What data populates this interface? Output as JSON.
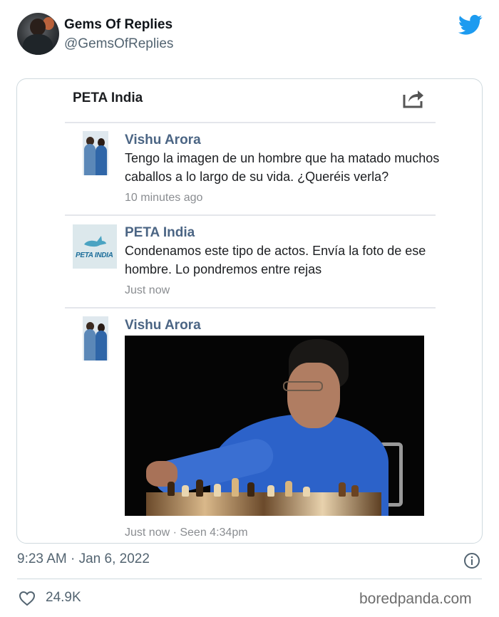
{
  "tweet": {
    "display_name": "Gems Of Replies",
    "handle": "@GemsOfReplies",
    "timestamp": "9:23 AM · Jan 6, 2022",
    "likes": "24.9K"
  },
  "embedded": {
    "page_title": "PETA India",
    "comments": [
      {
        "author": "Vishu Arora",
        "text": "Tengo la imagen de un hombre que ha matado muchos caballos a lo largo de su vida. ¿Queréis verla?",
        "time": "10 minutes ago"
      },
      {
        "author": "PETA India",
        "text": "Condenamos este tipo de actos. Envía la foto de ese hombre. Lo pondremos entre rejas",
        "time": "Just now",
        "logo_text": "PETA INDIA"
      },
      {
        "author": "Vishu Arora",
        "time": "Just now · Seen 4:34pm"
      }
    ]
  },
  "watermark": "boredpanda.com",
  "colors": {
    "twitter_blue": "#1d9bf0",
    "fb_author": "#4b6584",
    "muted": "#536471"
  }
}
